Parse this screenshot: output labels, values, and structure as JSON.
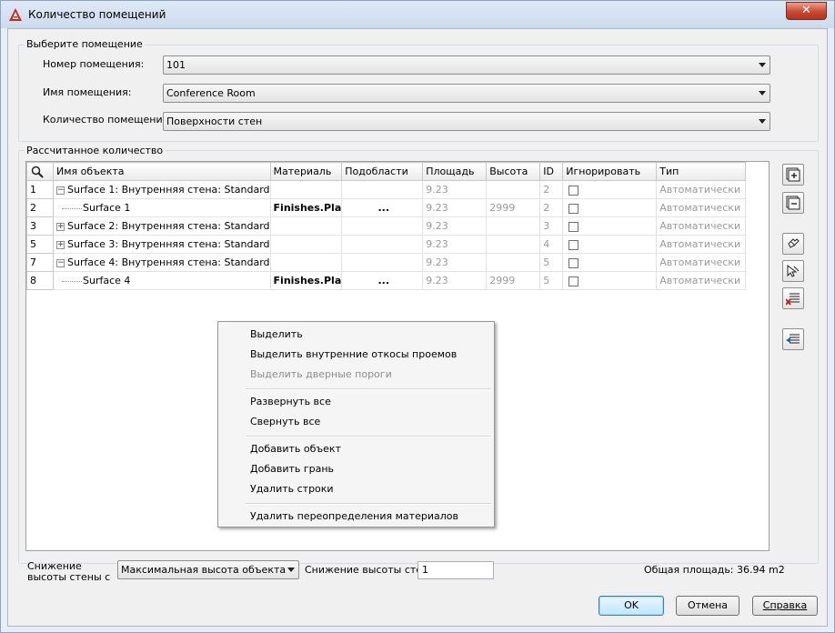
{
  "window": {
    "title": "Количество помещений",
    "close_label": "✕"
  },
  "select_group": {
    "legend": "Выберите помещение",
    "room_number_label": "Номер помещения:",
    "room_number_value": "101",
    "room_name_label": "Имя помещения:",
    "room_name_value": "Conference Room",
    "room_qty_label": "Количество помещений:",
    "room_qty_value": "Поверхности стен"
  },
  "calc_group": {
    "legend": "Рассчитанное количество",
    "columns": [
      "Имя объекта",
      "Материаль",
      "Подобласти",
      "Площадь",
      "Высота",
      "ID",
      "Игнорировать",
      "Тип"
    ],
    "rows": [
      {
        "num": "1",
        "toggle": "−",
        "name": "Surface 1: Внутренняя стена: Standard",
        "material": "",
        "sub": "",
        "area": "9.23",
        "height": "",
        "id": "2",
        "type": "Автоматически",
        "child": false
      },
      {
        "num": "2",
        "toggle": "",
        "name": "Surface 1",
        "material": "Finishes.Pla",
        "sub": "...",
        "area": "9.23",
        "height": "2999",
        "id": "2",
        "type": "Автоматически",
        "child": true
      },
      {
        "num": "3",
        "toggle": "+",
        "name": "Surface 2: Внутренняя стена: Standard",
        "material": "",
        "sub": "",
        "area": "9.23",
        "height": "",
        "id": "3",
        "type": "Автоматически",
        "child": false
      },
      {
        "num": "5",
        "toggle": "+",
        "name": "Surface 3: Внутренняя стена: Standard",
        "material": "",
        "sub": "",
        "area": "9.23",
        "height": "",
        "id": "4",
        "type": "Автоматически",
        "child": false
      },
      {
        "num": "7",
        "toggle": "−",
        "name": "Surface 4: Внутренняя стена: Standard",
        "material": "",
        "sub": "",
        "area": "9.23",
        "height": "",
        "id": "5",
        "type": "Автоматически",
        "child": false
      },
      {
        "num": "8",
        "toggle": "",
        "name": "Surface 4",
        "material": "Finishes.Pla",
        "sub": "...",
        "area": "9.23",
        "height": "2999",
        "id": "5",
        "type": "Автоматически",
        "child": true
      }
    ]
  },
  "context_menu": {
    "items": [
      {
        "label": "Выделить",
        "disabled": false
      },
      {
        "label": "Выделить внутренние откосы проемов",
        "disabled": false
      },
      {
        "label": "Выделить дверные пороги",
        "disabled": true
      },
      {
        "label": "Развернуть все",
        "disabled": false
      },
      {
        "label": "Свернуть все",
        "disabled": false
      },
      {
        "label": "Добавить объект",
        "disabled": false
      },
      {
        "label": "Добавить грань",
        "disabled": false
      },
      {
        "label": "Удалить строки",
        "disabled": false
      },
      {
        "label": "Удалить переопределения материалов",
        "disabled": false
      }
    ]
  },
  "footer": {
    "wall_reduction_label": "Снижение высоты стены с",
    "wall_reduction_value": "Максимальная высота объекта",
    "reduction_label": "Снижение высоты стен",
    "reduction_value": "1",
    "total_area": "Общая площадь: 36.94 m2",
    "ok": "OK",
    "cancel": "Отмена",
    "help": "Справка"
  },
  "colors": {
    "accent": "#c74a33",
    "title_bar": "#dfe9f6"
  }
}
